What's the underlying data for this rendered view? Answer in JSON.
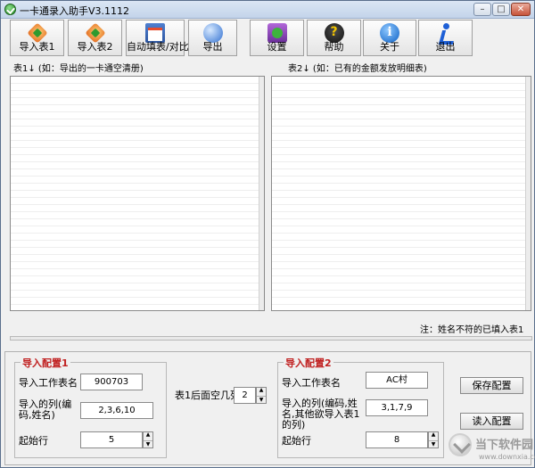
{
  "window": {
    "title": "一卡通录入助手V3.1112"
  },
  "toolbar": {
    "buttons": [
      {
        "label": "导入表1",
        "icon": "import-icon"
      },
      {
        "label": "导入表2",
        "icon": "import-icon"
      },
      {
        "label": "自动填表/对比",
        "icon": "table-check-icon"
      },
      {
        "label": "导出",
        "icon": "export-icon"
      },
      {
        "label": "设置",
        "icon": "settings-icon"
      },
      {
        "label": "帮助",
        "icon": "help-icon"
      },
      {
        "label": "关于",
        "icon": "info-icon"
      },
      {
        "label": "退出",
        "icon": "exit-runner-icon"
      }
    ]
  },
  "tables": {
    "table1_label": "表1↓  (如：导出的一卡通空清册)",
    "table2_label": "表2↓  (如：已有的金额发放明细表)"
  },
  "note": "注：姓名不符的已填入表1",
  "config1": {
    "title": "导入配置1",
    "sheet_label": "导入工作表名",
    "sheet_value": "900703",
    "cols_label": "导入的列(编码,姓名)",
    "cols_value": "2,3,6,10",
    "start_label": "起始行",
    "start_value": "5"
  },
  "middle": {
    "blank_cols_label": "表1后面空几列",
    "blank_cols_value": "2"
  },
  "config2": {
    "title": "导入配置2",
    "sheet_label": "导入工作表名",
    "sheet_value": "AC村",
    "cols_label": "导入的列(编码,姓名,其他欲导入表1的列)",
    "cols_value": "3,1,7,9",
    "start_label": "起始行",
    "start_value": "8"
  },
  "buttons": {
    "save": "保存配置",
    "load": "读入配置"
  },
  "watermark": {
    "text": "当下软件园",
    "sub": "www.downxia.com"
  }
}
